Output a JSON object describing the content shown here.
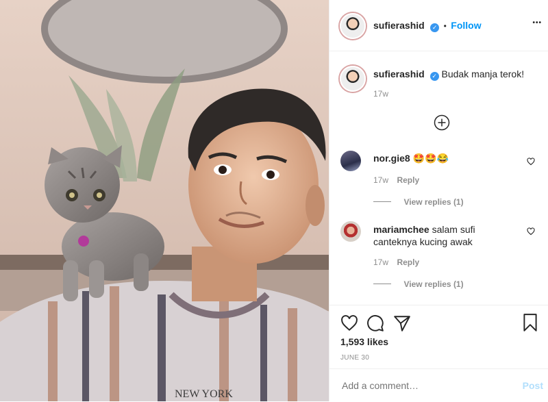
{
  "post": {
    "author": "sufierashid",
    "follow_label": "Follow",
    "dot": "•",
    "more_label": "•••",
    "caption": "Budak manja terok!",
    "caption_time": "17w",
    "likes": "1,593 likes",
    "date": "JUNE 30",
    "photo_text": "NEW YORK"
  },
  "comments": [
    {
      "user": "nor.gie8",
      "text": "🤩🤩😂",
      "time": "17w",
      "reply_label": "Reply",
      "view_replies": "View replies (1)"
    },
    {
      "user": "mariamchee",
      "text": "salam sufi canteknya kucing awak",
      "time": "17w",
      "reply_label": "Reply",
      "view_replies": "View replies (1)"
    }
  ],
  "composer": {
    "placeholder": "Add a comment…",
    "post_label": "Post"
  },
  "icons": {
    "verified": "verified-badge-icon",
    "more": "more-options-icon",
    "load_more": "plus-circle-icon",
    "like": "heart-icon",
    "comment": "comment-icon",
    "share": "share-icon",
    "save": "bookmark-icon"
  },
  "colors": {
    "accent": "#0095f6",
    "verified": "#3897f0",
    "muted": "#8e8e8e",
    "text": "#262626"
  }
}
